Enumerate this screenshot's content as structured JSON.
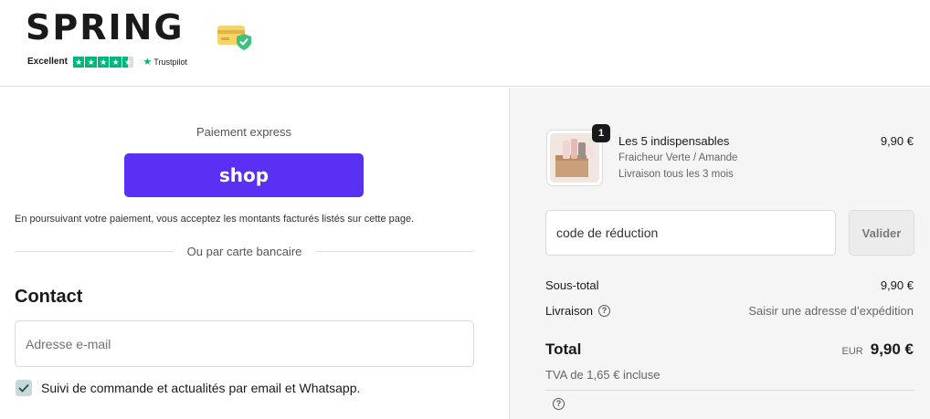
{
  "header": {
    "logo": "SPRING",
    "trust_rating": "Excellent",
    "trust_brand": "Trustpilot",
    "trust_star_color": "#00b67a",
    "secure_icon": "credit-card-shield-icon"
  },
  "express": {
    "title": "Paiement express",
    "shop_button_label": "shop",
    "shop_button_color": "#5a31f4",
    "notice": "En poursuivant votre paiement, vous acceptez les montants facturés listés sur cette page.",
    "divider_text": "Ou par carte bancaire"
  },
  "contact": {
    "heading": "Contact",
    "email_placeholder": "Adresse e-mail",
    "email_value": "",
    "consent_checked": true,
    "consent_label": "Suivi de commande et actualités par email et Whatsapp."
  },
  "summary": {
    "product": {
      "quantity": "1",
      "name": "Les 5 indispensables",
      "variant": "Fraicheur Verte / Amande",
      "frequency": "Livraison tous les 3 mois",
      "price": "9,90 €"
    },
    "discount": {
      "placeholder": "code de réduction",
      "button_label": "Valider"
    },
    "subtotal_label": "Sous-total",
    "subtotal_value": "9,90 €",
    "shipping_label": "Livraison",
    "shipping_value": "Saisir une adresse d’expédition",
    "total_label": "Total",
    "currency": "EUR",
    "total_value": "9,90 €",
    "vat_note": "TVA de 1,65 € incluse"
  }
}
